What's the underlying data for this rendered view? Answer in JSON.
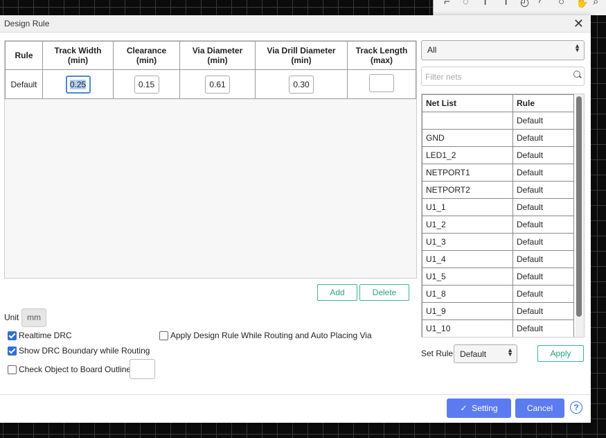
{
  "dialog": {
    "title": "Design Rule"
  },
  "rules_table": {
    "headers": [
      {
        "line1": "Rule",
        "line2": ""
      },
      {
        "line1": "Track Width",
        "line2": "(min)"
      },
      {
        "line1": "Clearance",
        "line2": "(min)"
      },
      {
        "line1": "Via Diameter",
        "line2": "(min)"
      },
      {
        "line1": "Via Drill Diameter",
        "line2": "(min)"
      },
      {
        "line1": "Track Length",
        "line2": "(max)"
      }
    ],
    "rows": [
      {
        "name": "Default",
        "track_width": "0.25",
        "clearance": "0.15",
        "via_diameter": "0.61",
        "via_drill": "0.30",
        "track_length": ""
      }
    ]
  },
  "buttons": {
    "add": "Add",
    "delete": "Delete",
    "apply": "Apply",
    "setting": "Setting",
    "cancel": "Cancel",
    "help": "?"
  },
  "unit": {
    "label": "Unit",
    "value": "mm"
  },
  "options": {
    "realtime_drc": {
      "label": "Realtime DRC",
      "checked": true
    },
    "show_drc_boundary": {
      "label": "Show DRC Boundary while Routing",
      "checked": true
    },
    "check_board_outline": {
      "label": "Check Object to Board Outline",
      "checked": false,
      "value": ""
    },
    "apply_while_routing": {
      "label": "Apply Design Rule While Routing and Auto Placing Via",
      "checked": false
    }
  },
  "filter": {
    "selected": "All",
    "search_placeholder": "Filter nets"
  },
  "net_list": {
    "headers": [
      "Net List",
      "Rule"
    ],
    "rows": [
      {
        "net": "",
        "rule": "Default"
      },
      {
        "net": "GND",
        "rule": "Default"
      },
      {
        "net": "LED1_2",
        "rule": "Default"
      },
      {
        "net": "NETPORT1",
        "rule": "Default"
      },
      {
        "net": "NETPORT2",
        "rule": "Default"
      },
      {
        "net": "U1_1",
        "rule": "Default"
      },
      {
        "net": "U1_2",
        "rule": "Default"
      },
      {
        "net": "U1_3",
        "rule": "Default"
      },
      {
        "net": "U1_4",
        "rule": "Default"
      },
      {
        "net": "U1_5",
        "rule": "Default"
      },
      {
        "net": "U1_8",
        "rule": "Default"
      },
      {
        "net": "U1_9",
        "rule": "Default"
      },
      {
        "net": "U1_10",
        "rule": "Default"
      }
    ]
  },
  "set_rule": {
    "label": "Set Rule",
    "selected": "Default"
  },
  "colors": {
    "primary": "#5b7cf0",
    "accent_outline": "#3bb397",
    "checkbox": "#2f6fd6"
  }
}
